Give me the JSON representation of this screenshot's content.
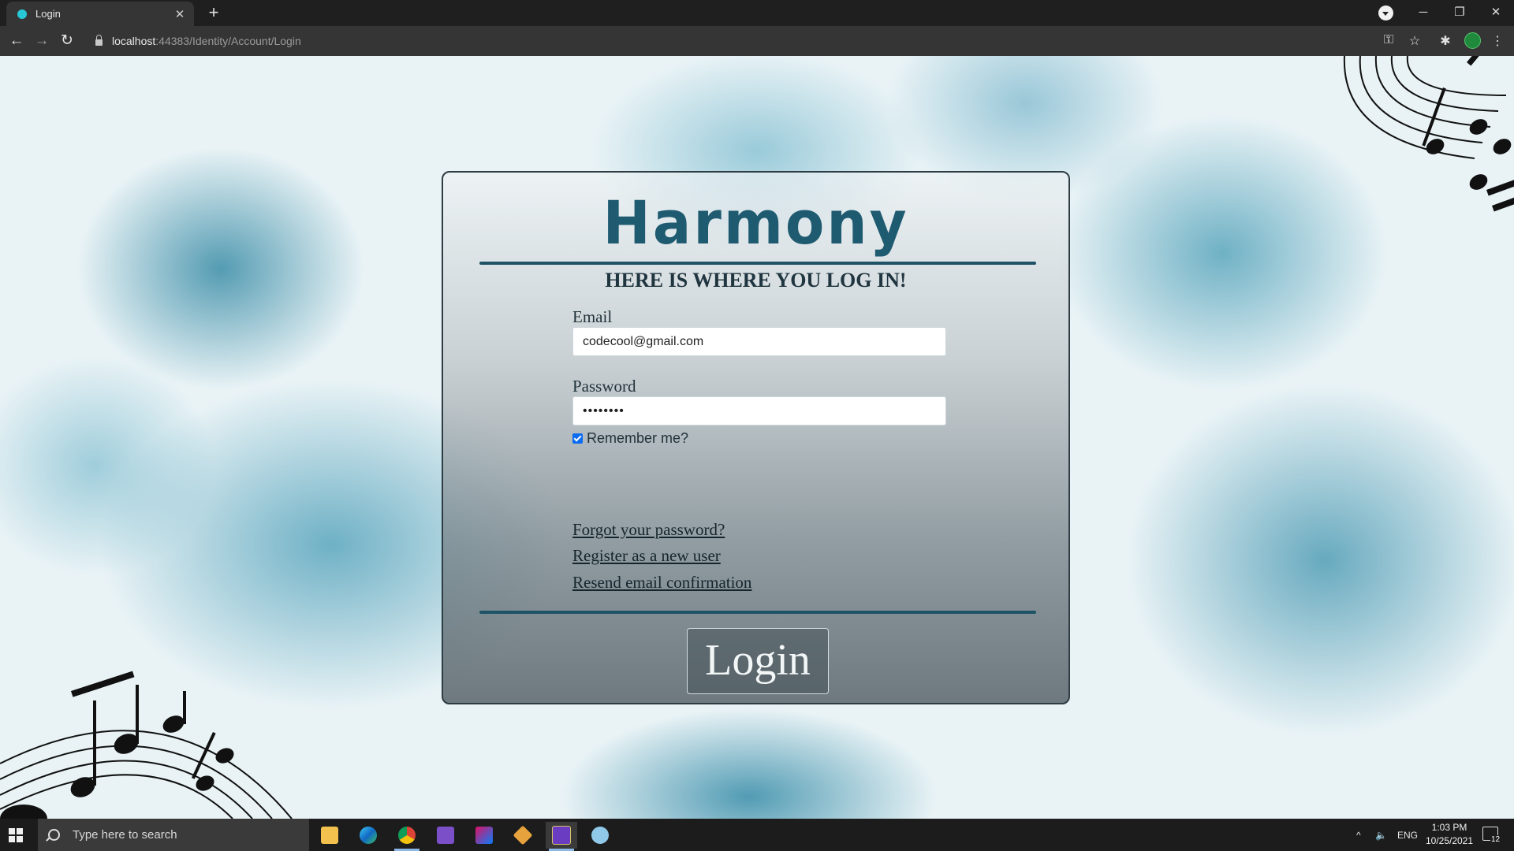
{
  "browser": {
    "tab_title": "Login",
    "tab_close": "✕",
    "new_tab": "+",
    "url_host": "localhost",
    "url_rest": ":44383/Identity/Account/Login",
    "window": {
      "minimize": "─",
      "restore": "❐",
      "close": "✕"
    }
  },
  "page": {
    "brand": "Harmony",
    "heading": "HERE IS WHERE YOU LOG IN!",
    "email_label": "Email",
    "email_value": "codecool@gmail.com",
    "password_label": "Password",
    "password_value": "codecool",
    "remember_label": "Remember me?",
    "remember_checked": true,
    "links": {
      "forgot": "Forgot your password?",
      "register": "Register as a new user",
      "resend": "Resend email confirmation"
    },
    "login_button": "Login",
    "accent_color": "#1e5a70"
  },
  "taskbar": {
    "search_placeholder": "Type here to search",
    "language": "ENG",
    "time": "1:03 PM",
    "date": "10/25/2021",
    "notification_count": "12",
    "apps": [
      "file-explorer-icon",
      "edge-icon",
      "chrome-icon",
      "visual-studio-icon",
      "jetbrains-rider-icon",
      "git-icon",
      "visual-studio-preview-icon",
      "paint-icon"
    ]
  }
}
